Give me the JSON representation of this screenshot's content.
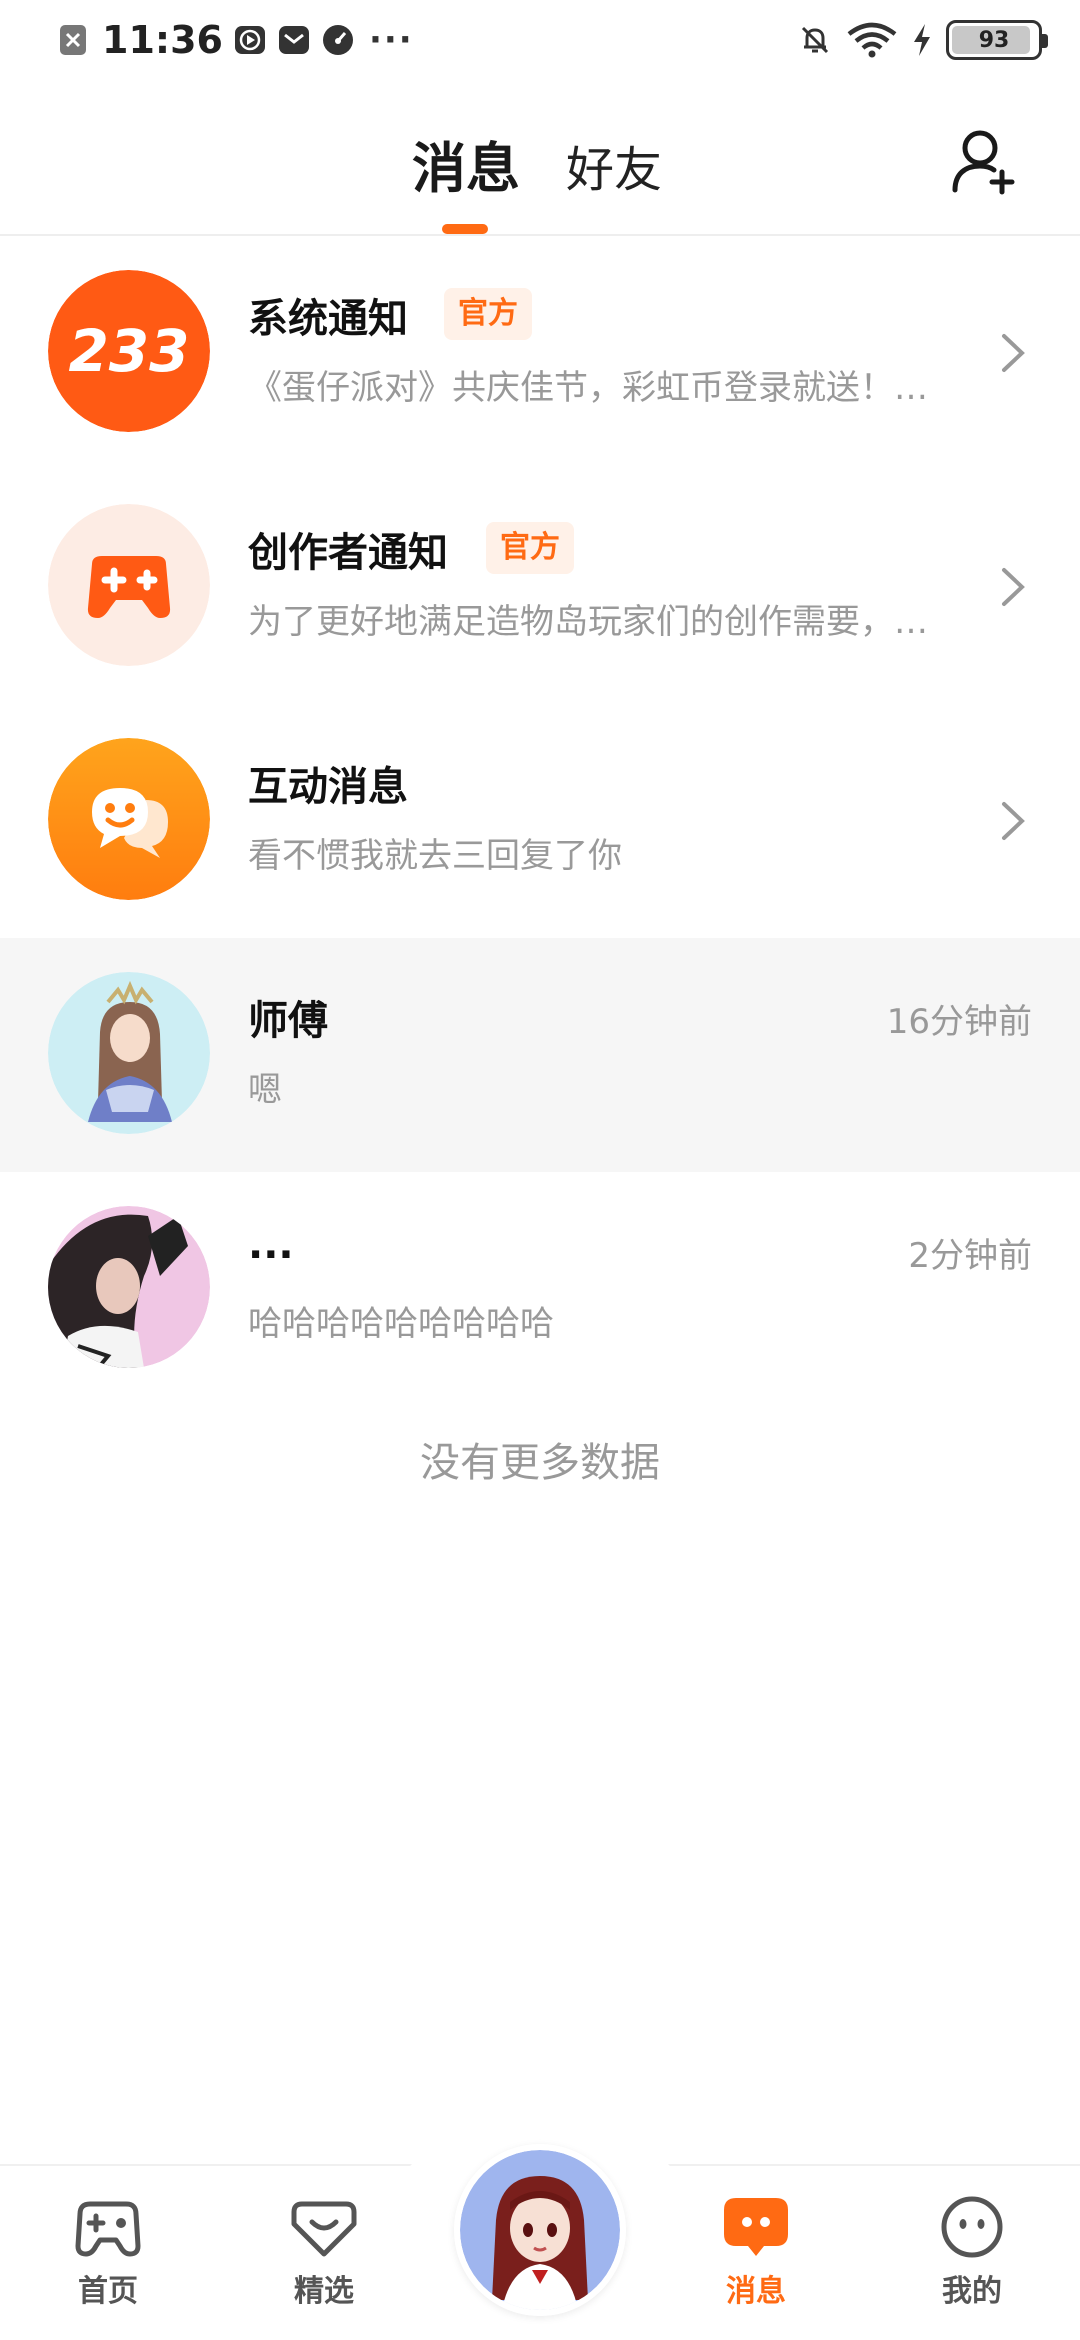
{
  "status_bar": {
    "time": "11:36",
    "battery": "93",
    "battery_level": 0.93,
    "icons": [
      "close-square-icon",
      "play-icon",
      "mail-icon",
      "speedometer-icon",
      "bell-off-icon",
      "wifi-icon",
      "charging-icon",
      "battery-icon"
    ],
    "more": "···"
  },
  "header": {
    "tabs": [
      {
        "label": "消息",
        "active": true
      },
      {
        "label": "好友",
        "active": false
      }
    ],
    "add_friend_icon": "add-user-icon",
    "accent_color": "#ff6a13"
  },
  "messages": [
    {
      "title": "系统通知",
      "badge": "官方",
      "subtitle": "《蛋仔派对》共庆佳节，彩虹币登录就送！…",
      "avatar": "233-logo",
      "avatar_text": "233"
    },
    {
      "title": "创作者通知",
      "badge": "官方",
      "subtitle": "为了更好地满足造物岛玩家们的创作需要，…",
      "avatar": "gamepad-icon"
    },
    {
      "title": "互动消息",
      "subtitle": "看不惯我就去三回复了你",
      "avatar": "chat-smile-icon"
    },
    {
      "title": "师傅",
      "subtitle": "嗯",
      "time": "16分钟前",
      "avatar": "anime-avatar-girl"
    },
    {
      "title": "...",
      "subtitle": "哈哈哈哈哈哈哈哈哈",
      "time": "2分钟前",
      "avatar": "anime-avatar-dark"
    }
  ],
  "no_more": "没有更多数据",
  "bottom_nav": [
    {
      "label": "首页",
      "icon": "gamepad-outline-icon",
      "active": false
    },
    {
      "label": "精选",
      "icon": "heart-chat-icon",
      "active": false
    },
    {
      "label": "",
      "icon": "center-avatar",
      "active": false
    },
    {
      "label": "消息",
      "icon": "message-filled-icon",
      "active": true
    },
    {
      "label": "我的",
      "icon": "smile-face-icon",
      "active": false
    }
  ]
}
